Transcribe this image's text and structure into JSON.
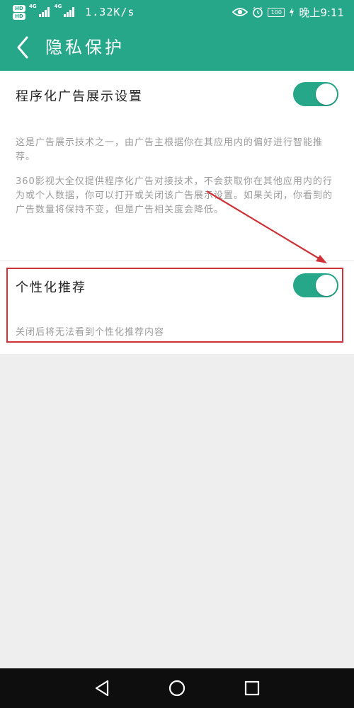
{
  "status_bar": {
    "hd1": "HD",
    "hd2": "HD",
    "net1": "4G",
    "net2": "4G",
    "speed": "1.32K/s",
    "battery": "100",
    "time": "晚上9:11",
    "icons": [
      "eye-icon",
      "alarm-icon",
      "battery-icon",
      "charging-icon"
    ]
  },
  "header": {
    "title": "隐私保护",
    "back_icon": "chevron-left-icon"
  },
  "settings": {
    "programmatic_ads": {
      "title": "程序化广告展示设置",
      "enabled": true,
      "desc1": "这是广告展示技术之一，由广告主根据你在其应用内的偏好进行智能推荐。",
      "desc2": "360影视大全仅提供程序化广告对接技术，不会获取你在其他应用内的行为或个人数据，你可以打开或关闭该广告展示设置。如果关闭，你看到的广告数量将保持不变，但是广告相关度会降低。"
    },
    "personalized": {
      "title": "个性化推荐",
      "enabled": true,
      "desc": "关闭后将无法看到个性化推荐内容"
    }
  },
  "annotation": {
    "color": "#cf3237"
  },
  "nav_bar": {
    "icons": [
      "back-triangle-icon",
      "home-circle-icon",
      "recents-square-icon"
    ]
  },
  "colors": {
    "accent": "#27a78a",
    "background": "#eeeeee",
    "description_text": "#9b9b9b"
  }
}
